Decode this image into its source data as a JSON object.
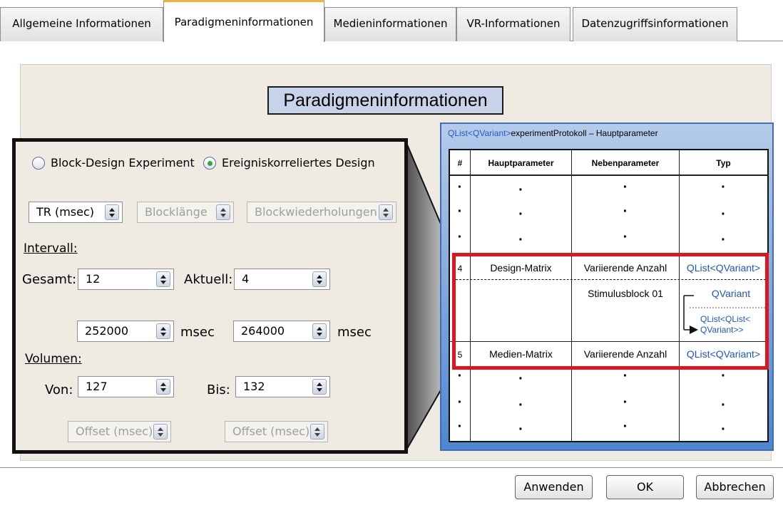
{
  "tabs": [
    {
      "label": "Allgemeine Informationen"
    },
    {
      "label": "Paradigmeninformationen"
    },
    {
      "label": "Medieninformationen"
    },
    {
      "label": "VR-Informationen"
    },
    {
      "label": "Datenzugriffsinformationen"
    }
  ],
  "active_tab": "Paradigmeninformationen",
  "title": "Paradigmeninformationen",
  "design": {
    "option_block": "Block-Design Experiment",
    "option_event": "Ereigniskorreliertes Design",
    "selected": "Ereigniskorreliertes Design"
  },
  "selectors": {
    "tr": "TR (msec)",
    "block_length": "Blocklänge",
    "block_repeats": "Blockwiederholungen"
  },
  "interval": {
    "label": "Intervall:",
    "total_label": "Gesamt:",
    "total_value": "12",
    "current_label": "Aktuell:",
    "current_value": "4",
    "from_msec": "252000",
    "to_msec": "264000",
    "unit": "msec"
  },
  "volumes": {
    "label": "Volumen:",
    "from_label": "Von:",
    "from_value": "127",
    "to_label": "Bis:",
    "to_value": "132",
    "offset1": "Offset (msec)",
    "offset2": "Offset (msec)"
  },
  "protocol": {
    "header_type": "QList<QVariant>",
    "header_rest": "experimentProtokoll – Hauptparameter",
    "columns": [
      "#",
      "Hauptparameter",
      "Nebenparameter",
      "Typ"
    ],
    "dot": "·",
    "row4": {
      "num": "4",
      "main": "Design-Matrix",
      "sub": "Variierende Anzahl",
      "type": "QList<QVariant>"
    },
    "sub_row": {
      "sub": "Stimulusblock 01",
      "type_a": "QVariant",
      "type_b1": "QList<QList<",
      "type_b2": "QVariant>>"
    },
    "row5": {
      "num": "5",
      "main": "Medien-Matrix",
      "sub": "Variierende Anzahl",
      "type": "QList<QVariant>"
    }
  },
  "colors": {
    "highlight": "#e0141c",
    "panel_blue": "#4f86d2",
    "title_bg": "#c7d3e8",
    "type_text": "#1f55c7",
    "active_tab_accent": "#f0b535"
  },
  "buttons": {
    "apply": "Anwenden",
    "ok": "OK",
    "cancel": "Abbrechen"
  }
}
